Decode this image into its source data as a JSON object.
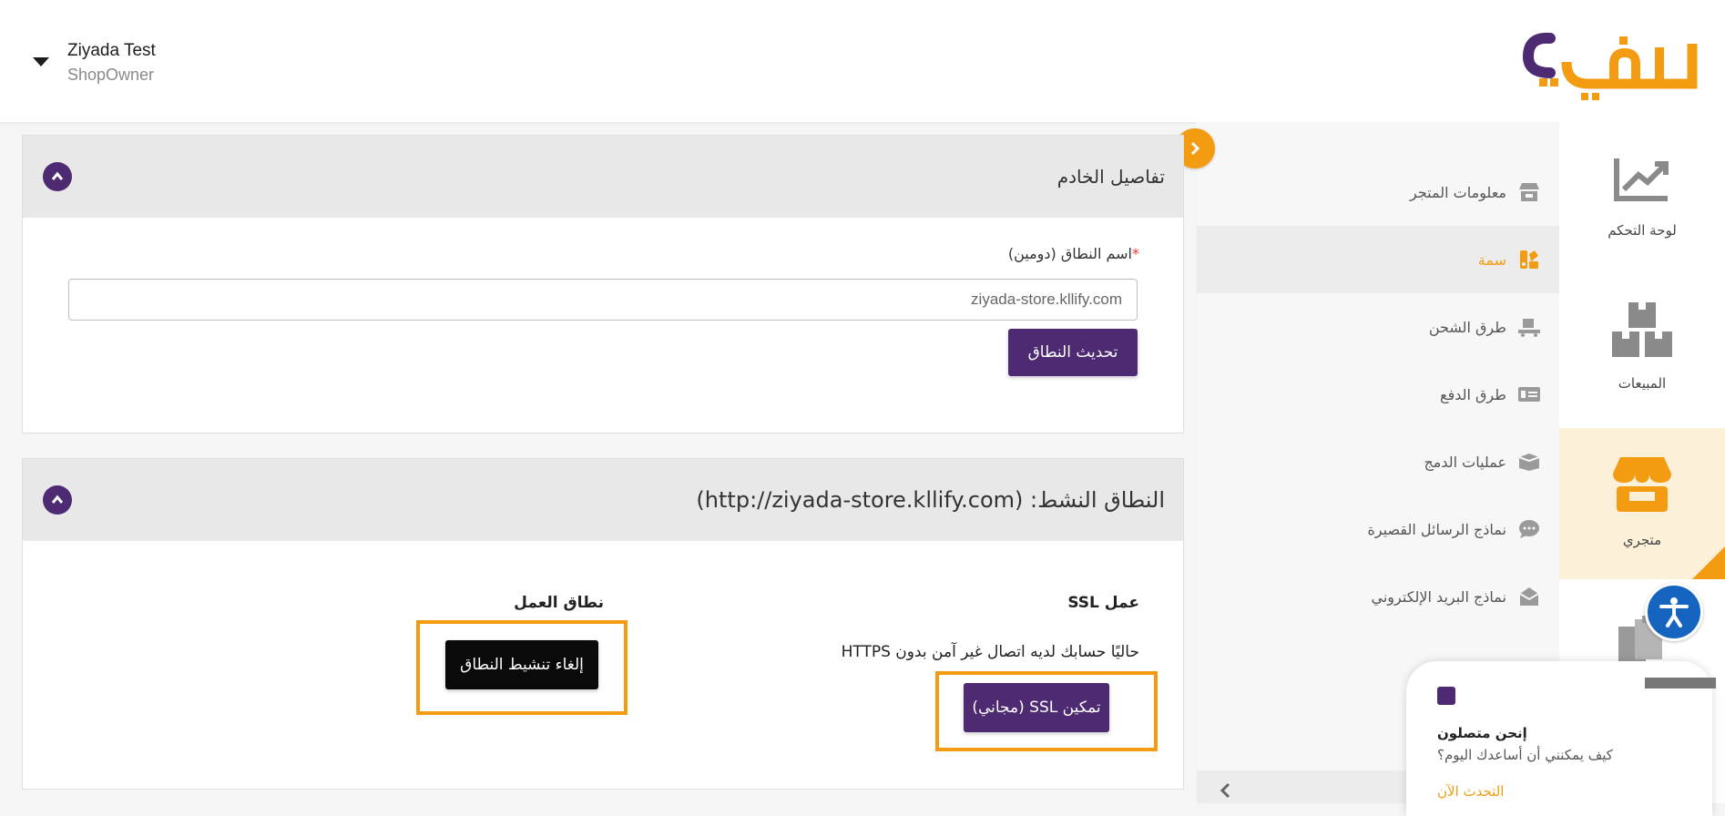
{
  "header": {
    "user_name": "Ziyada Test",
    "user_role": "ShopOwner",
    "logo_text": "كليفا"
  },
  "rail": [
    {
      "label": "لوحة التحكم",
      "icon": "chart-trend-icon"
    },
    {
      "label": "المبيعات",
      "icon": "boxes-icon"
    },
    {
      "label": "متجري",
      "icon": "storefront-icon",
      "active": true
    },
    {
      "label": "",
      "icon": "clipboard-icon"
    }
  ],
  "submenu": [
    {
      "label": "معلومات المتجر",
      "icon": "store-icon"
    },
    {
      "label": "سمة",
      "icon": "theme-icon",
      "active": true
    },
    {
      "label": "طرق الشحن",
      "icon": "shipping-icon"
    },
    {
      "label": "طرق الدفع",
      "icon": "payment-icon"
    },
    {
      "label": "عمليات الدمج",
      "icon": "integration-icon"
    },
    {
      "label": "نماذج الرسائل القصيرة",
      "icon": "sms-icon"
    },
    {
      "label": "نماذج البريد الإلكتروني",
      "icon": "email-icon"
    }
  ],
  "server_panel": {
    "title": "تفاصيل الخادم",
    "field_required": "*",
    "field_label": "اسم النطاق (دومين)",
    "domain_value": "ziyada-store.kllify.com",
    "update_button": "تحديث النطاق"
  },
  "active_panel": {
    "title": "النطاق النشط: (http://ziyada-store.kllify.com)",
    "ssl_heading": "عمل SSL",
    "ssl_desc": "حاليًا حسابك لديه اتصال غير آمن بدون HTTPS",
    "ssl_button": "تمكين SSL (مجاني)",
    "domain_heading": "نطاق العمل",
    "deactivate_button": "إلغاء تنشيط النطاق"
  },
  "chat": {
    "line1": "إنحن متصلون",
    "line2": "كيف يمكنني أن أساعدك اليوم؟",
    "cta": "التحدث الآن"
  },
  "colors": {
    "brand_purple": "#4d2a72",
    "brand_orange": "#f39c12",
    "highlight": "#f39c12"
  }
}
